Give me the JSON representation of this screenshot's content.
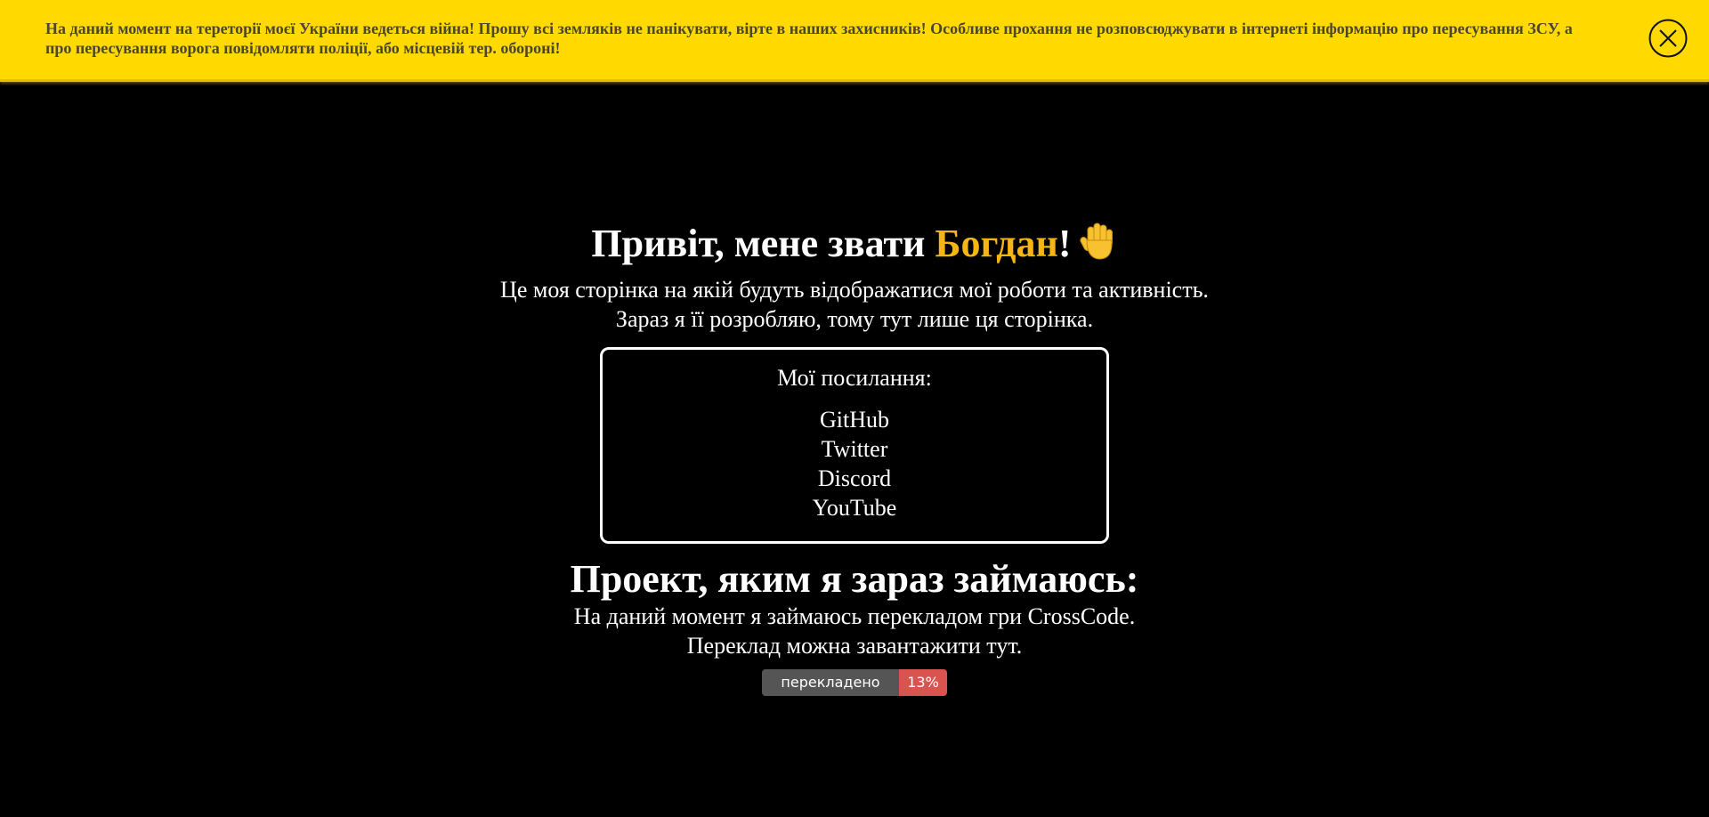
{
  "banner": {
    "text": "На даний момент на тереторії моєї України ведеться війна! Прошу всі земляків не панікувати, вірте в наших захисників! Особливе прохання не розповсюджувати в інтернеті інформацію про пересування ЗСУ, а про пересування ворога повідомляти поліції, або місцевій тер. обороні!",
    "close_icon": "close-circle-x",
    "background_color": "#ffd900"
  },
  "hero": {
    "greeting": "Привіт, мене звати ",
    "name": "Богдан",
    "exclamation": "!",
    "icon": "raised-hand",
    "accent_color": "#f5b514",
    "intro_line1": "Це моя сторінка на якій будуть відображатися мої роботи та активність.",
    "intro_line2": "Зараз я її розробляю, тому тут лише ця сторінка."
  },
  "links": {
    "title": "Мої посилання:",
    "items": [
      {
        "label": "GitHub"
      },
      {
        "label": "Twitter"
      },
      {
        "label": "Discord"
      },
      {
        "label": "YouTube"
      }
    ]
  },
  "project": {
    "heading": "Проект, яким я зараз займаюсь:",
    "line1": "На даний момент я займаюсь перекладом гри CrossCode.",
    "line2": "Переклад можна завантажити тут.",
    "badge": {
      "label": "перекладено",
      "value": "13%",
      "value_color": "#d9534f",
      "progress_percent": 13
    }
  }
}
